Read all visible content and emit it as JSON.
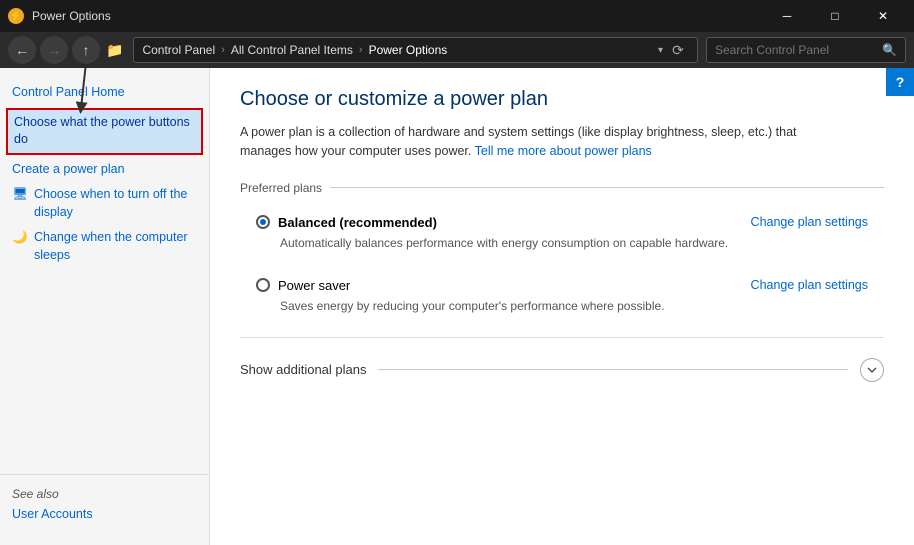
{
  "titleBar": {
    "icon": "⚡",
    "title": "Power Options",
    "minimizeLabel": "─",
    "maximizeLabel": "□",
    "closeLabel": "✕"
  },
  "navBar": {
    "back": "←",
    "forward": "→",
    "up": "↑",
    "folderIcon": "📁",
    "breadcrumbs": [
      {
        "label": "Control Panel",
        "active": false
      },
      {
        "label": "All Control Panel Items",
        "active": false
      },
      {
        "label": "Power Options",
        "active": true
      }
    ],
    "searchPlaceholder": "Search Control Panel",
    "refreshLabel": "⟳"
  },
  "sidebar": {
    "items": [
      {
        "id": "control-panel-home",
        "label": "Control Panel Home",
        "icon": "",
        "active": false,
        "hasIcon": false
      },
      {
        "id": "choose-power-buttons",
        "label": "Choose what the power buttons do",
        "icon": "",
        "active": true,
        "hasIcon": false
      },
      {
        "id": "create-power-plan",
        "label": "Create a power plan",
        "icon": "",
        "active": false,
        "hasIcon": false
      },
      {
        "id": "turn-off-display",
        "label": "Choose when to turn off the display",
        "icon": "🖥",
        "active": false,
        "hasIcon": true
      },
      {
        "id": "change-sleep",
        "label": "Change when the computer sleeps",
        "icon": "🌙",
        "active": false,
        "hasIcon": true
      }
    ],
    "seeAlso": {
      "label": "See also",
      "links": [
        {
          "id": "user-accounts",
          "label": "User Accounts"
        }
      ]
    }
  },
  "content": {
    "title": "Choose or customize a power plan",
    "description": "A power plan is a collection of hardware and system settings (like display brightness, sleep, etc.) that manages how your computer uses power.",
    "descriptionLink": "Tell me more about power plans",
    "preferredPlansLabel": "Preferred plans",
    "plans": [
      {
        "id": "balanced",
        "name": "Balanced (recommended)",
        "bold": true,
        "checked": true,
        "description": "Automatically balances performance with energy consumption on capable hardware.",
        "changeLinkLabel": "Change plan settings"
      },
      {
        "id": "power-saver",
        "name": "Power saver",
        "bold": false,
        "checked": false,
        "description": "Saves energy by reducing your computer's performance where possible.",
        "changeLinkLabel": "Change plan settings"
      }
    ],
    "showAdditionalPlans": "Show additional plans",
    "helpLabel": "?"
  }
}
